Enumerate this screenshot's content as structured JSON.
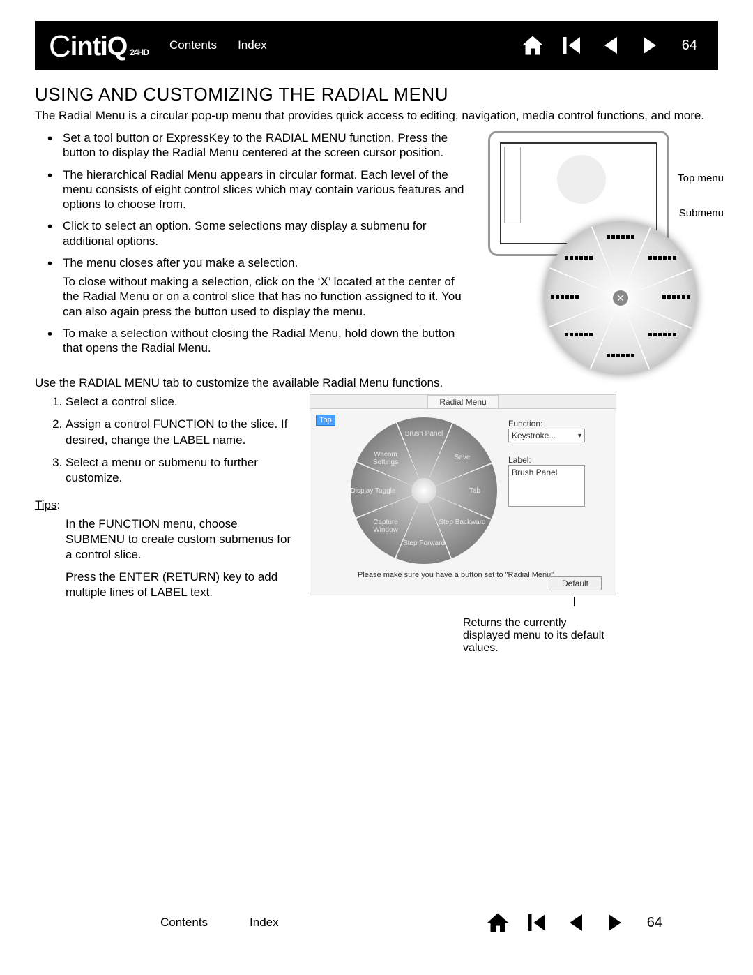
{
  "brand": "intiQ",
  "brand_model": "24HD",
  "header": {
    "contents": "Contents",
    "index": "Index",
    "page": "64"
  },
  "footer": {
    "contents": "Contents",
    "index": "Index",
    "page": "64"
  },
  "title": "USING AND CUSTOMIZING THE RADIAL MENU",
  "intro": "The Radial Menu is a circular pop-up menu that provides quick access to editing, navigation, media control functions, and more.",
  "bullets": [
    "Set a tool button or ExpressKey to the RADIAL MENU function.  Press the button to display the Radial Menu centered at the screen cursor position.",
    "The hierarchical Radial Menu appears in circular format.  Each level of the menu consists of eight control slices which may contain various features and options to choose from.",
    "Click to select an option.  Some selections may display a submenu for additional options.",
    "The menu closes after you make a selection.",
    "To make a selection without closing the Radial Menu, hold down the button that opens the Radial Menu."
  ],
  "bullet3_sub": "To close without making a selection, click on the ‘X’ located at the center of the Radial Menu or on a control slice that has no function assigned to it.  You can also again press the button used to display the menu.",
  "figure1": {
    "top_menu": "Top menu",
    "submenu": "Submenu"
  },
  "mid_line": "Use the RADIAL MENU tab to customize the available Radial Menu functions.",
  "steps": [
    "Select a control slice.",
    "Assign a control FUNCTION to the slice.  If desired, change the LABEL name.",
    "Select a menu or submenu to further customize."
  ],
  "tips_label": "Tips",
  "tips": [
    "In the FUNCTION menu, choose SUBMENU to create custom submenus for a control slice.",
    "Press the ENTER (RETURN) key to add multiple lines of LABEL text."
  ],
  "panel": {
    "tab": "Radial Menu",
    "top_chip": "Top",
    "slices": {
      "n": "Brush Panel",
      "ne": "Save",
      "e": "Tab",
      "se": "Step Backward",
      "s": "Step Forward",
      "sw": "Capture Window",
      "w": "Display Toggle",
      "nw": "Wacom Settings"
    },
    "function_label": "Function:",
    "function_value": "Keystroke...",
    "label_label": "Label:",
    "label_value": "Brush Panel",
    "note": "Please make sure you have a button set to \"Radial Menu\".",
    "default": "Default"
  },
  "default_caption": "Returns the currently displayed menu to its default values."
}
